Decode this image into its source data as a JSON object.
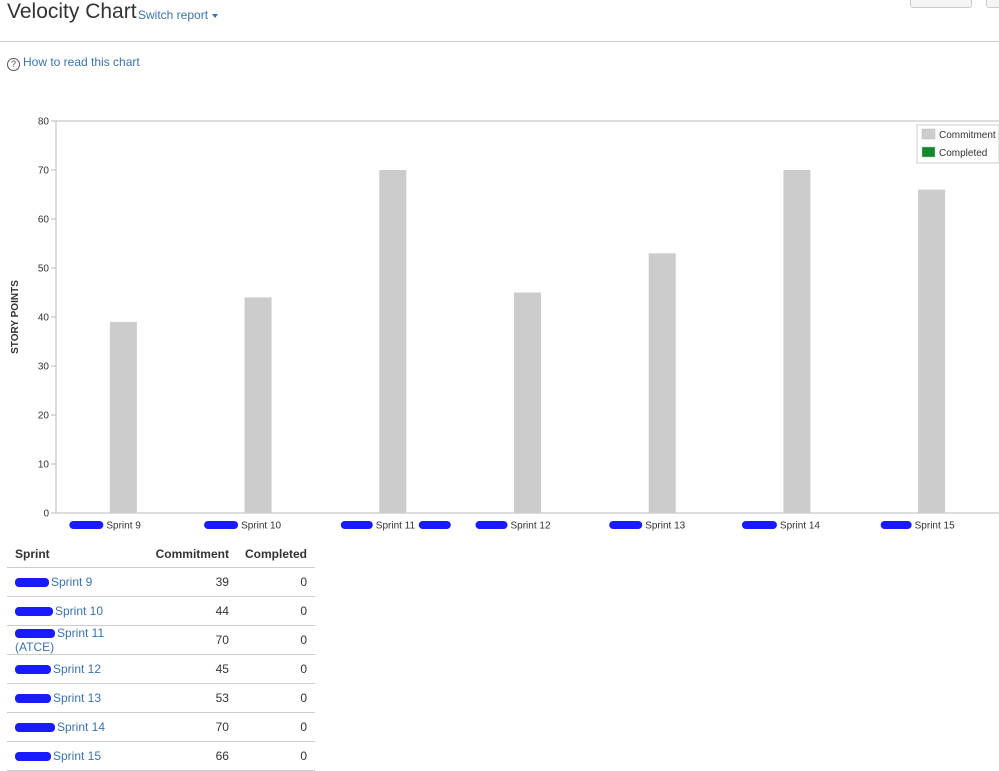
{
  "header": {
    "title": "Velocity Chart",
    "switch_label": "Switch report",
    "help_label": "How to read this chart"
  },
  "chart_data": {
    "type": "bar",
    "categories": [
      "Sprint 9",
      "Sprint 10",
      "Sprint 11",
      "Sprint 12",
      "Sprint 13",
      "Sprint 14",
      "Sprint 15"
    ],
    "series": [
      {
        "name": "Commitment",
        "values": [
          39,
          44,
          70,
          45,
          53,
          70,
          66
        ],
        "color": "#cccccc"
      },
      {
        "name": "Completed",
        "values": [
          0,
          0,
          0,
          0,
          0,
          0,
          0
        ],
        "color": "#14892c"
      }
    ],
    "ylabel": "STORY POINTS",
    "ylim": [
      0,
      80
    ],
    "yticks": [
      0,
      10,
      20,
      30,
      40,
      50,
      60,
      70,
      80
    ],
    "legend_position": "top-right",
    "grid": false
  },
  "table": {
    "headers": [
      "Sprint",
      "Commitment",
      "Completed"
    ],
    "rows": [
      {
        "sprint": "Sprint 9",
        "commitment": "39",
        "completed": "0"
      },
      {
        "sprint": "Sprint 10",
        "commitment": "44",
        "completed": "0"
      },
      {
        "sprint": "Sprint 11 (ATCE)",
        "commitment": "70",
        "completed": "0"
      },
      {
        "sprint": "Sprint 12",
        "commitment": "45",
        "completed": "0"
      },
      {
        "sprint": "Sprint 13",
        "commitment": "53",
        "completed": "0"
      },
      {
        "sprint": "Sprint 14",
        "commitment": "70",
        "completed": "0"
      },
      {
        "sprint": "Sprint 15",
        "commitment": "66",
        "completed": "0"
      }
    ]
  },
  "colors": {
    "link": "#3b73af",
    "commitment": "#cccccc",
    "completed": "#14892c",
    "redaction": "#1a1aff"
  }
}
